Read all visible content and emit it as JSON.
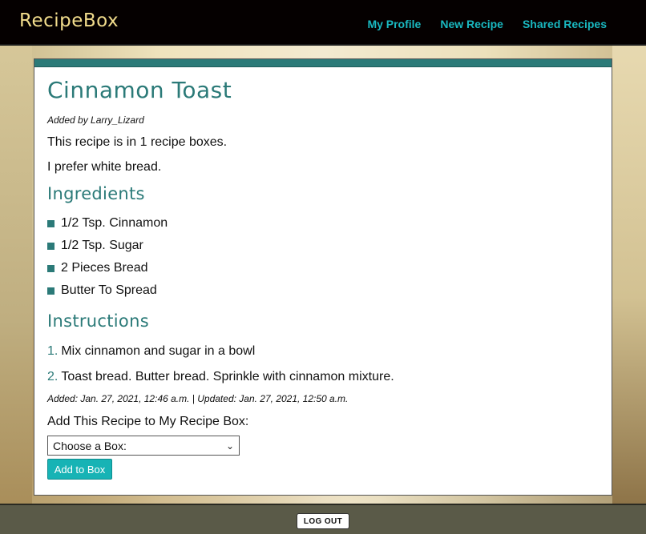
{
  "app": {
    "logo": "RecipeBox"
  },
  "nav": {
    "items": [
      "My Profile",
      "New Recipe",
      "Shared Recipes"
    ]
  },
  "recipe": {
    "title": "Cinnamon Toast",
    "added_by": "Added by Larry_Lizard",
    "boxes_count": "This recipe is in 1 recipe boxes.",
    "note": "I prefer white bread.",
    "ingredients_heading": "Ingredients",
    "ingredients": [
      "1/2 Tsp. Cinnamon",
      "1/2 Tsp. Sugar",
      "2 Pieces Bread",
      "Butter To Spread"
    ],
    "instructions_heading": "Instructions",
    "instructions": [
      {
        "num": "1.",
        "text": "Mix cinnamon and sugar in a bowl"
      },
      {
        "num": "2.",
        "text": "Toast bread. Butter bread. Sprinkle with cinnamon mixture."
      }
    ],
    "meta": "Added: Jan. 27, 2021, 12:46 a.m. | Updated: Jan. 27, 2021, 12:50 a.m."
  },
  "add_form": {
    "label": "Add This Recipe to My Recipe Box:",
    "select_value": "Choose a Box:",
    "button": "Add to Box"
  },
  "footer": {
    "logout": "LOG OUT"
  },
  "colors": {
    "accent": "#2b7a78",
    "nav": "#19b8c0",
    "button": "#17b3b5",
    "logo": "#f2dc8c"
  }
}
